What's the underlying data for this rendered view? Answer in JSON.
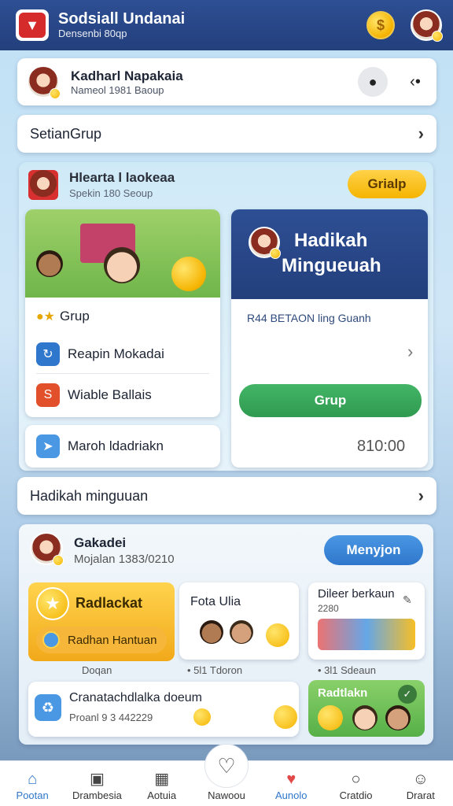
{
  "header": {
    "title": "Sodsiall Undanai",
    "subtitle": "Densenbi 80qp"
  },
  "profile": {
    "name": "Kadharl Napakaia",
    "sub": "Nameol 1981 Baoup"
  },
  "row_setting": {
    "label": "SetianGrup"
  },
  "group_panel": {
    "title": "Hlearta l laokeaa",
    "sub": "Spekin 180 Seoup",
    "button": "Grialp",
    "left_card": {
      "item1": "Grup",
      "item2": "Reapin Mokadai",
      "item3": "Wiable Ballais"
    },
    "promo": {
      "title_line1": "Hadikah",
      "title_line2": "Mingueuah",
      "info": "R44 BETAON ling Guanh",
      "button": "Grup",
      "amount": "810:00"
    },
    "bottom_left": "Maroh ldadriakn"
  },
  "row_hadikah": {
    "label": "Hadikah minguuan"
  },
  "lower_panel": {
    "name": "Gakadei",
    "sub": "Mojalan 1383/0210",
    "button": "Menyjon",
    "tile1": {
      "title": "Radlackat",
      "button": "Radhan Hantuan",
      "caption": "Doqan"
    },
    "tile2": {
      "title": "Fota Ulia",
      "caption": "• 5l1 Tdoron"
    },
    "tile3": {
      "title": "Dileer berkaun",
      "sub": "2280",
      "caption": "• 3l1 Sdeaun"
    },
    "row": {
      "title": "Cranatachdlalka doeum",
      "sub": "Proanl 9 3 442229"
    },
    "tile4": {
      "title": "Radtlakn"
    }
  },
  "nav": [
    {
      "label": "Pootan",
      "icon": "home-icon"
    },
    {
      "label": "Drambesia",
      "icon": "store-icon"
    },
    {
      "label": "Aotuia",
      "icon": "calendar-icon"
    },
    {
      "label": "Nawoou",
      "icon": "heart-icon"
    },
    {
      "label": "Aunolo",
      "icon": "heart-badge-icon"
    },
    {
      "label": "Cratdio",
      "icon": "chat-icon"
    },
    {
      "label": "Drarat",
      "icon": "user-icon"
    }
  ],
  "colors": {
    "header_bg": "#233f7c",
    "accent_yellow": "#f5b400",
    "accent_blue": "#2f77cc",
    "accent_green": "#2f9a50"
  }
}
